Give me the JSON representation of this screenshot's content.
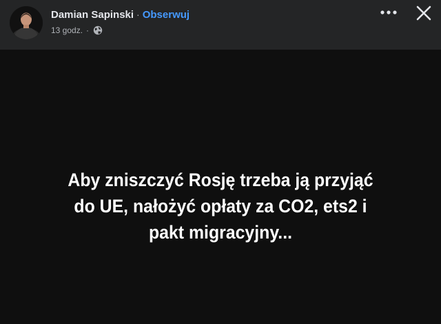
{
  "post": {
    "author": "Damian Sapinski",
    "separator": "·",
    "follow_label": "Obserwuj",
    "time": "13 godz.",
    "privacy_icon": "globe-icon",
    "text": "Aby zniszczyć Rosję trzeba ją przyjąć\ndo UE, nałożyć opłaty za CO2,  ets2 i\npakt migracyjny..."
  },
  "controls": {
    "more_icon": "more-options-icon",
    "close_icon": "close-icon"
  },
  "colors": {
    "header_bg": "#242526",
    "body_bg": "#0f0f0f",
    "follow": "#4599ff",
    "text": "#ffffff",
    "muted": "#b0b3b8"
  }
}
